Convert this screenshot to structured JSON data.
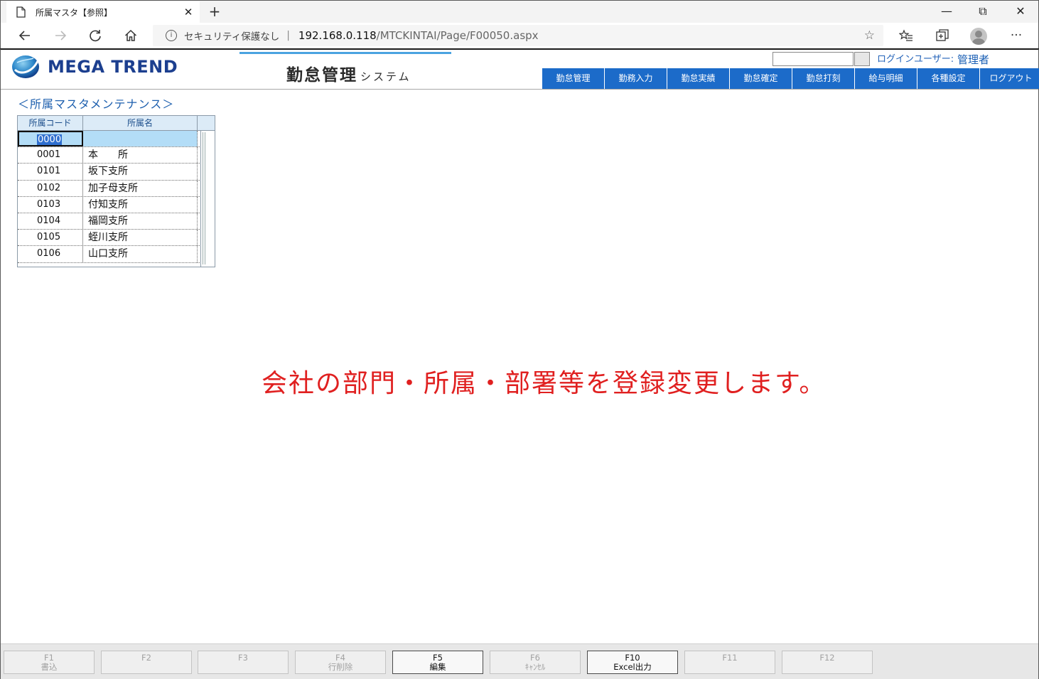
{
  "browser": {
    "tab_title": "所属マスタ【参照】",
    "tab_close": "✕",
    "new_tab": "+",
    "minimize": "—",
    "restore": "⧉",
    "close": "✕",
    "security_label": "セキュリティ保護なし",
    "separator": "|",
    "url_host": "192.168.0.118",
    "url_path": "/MTCKINTAI/Page/F00050.aspx",
    "more": "···"
  },
  "header": {
    "brand": "MEGA TREND",
    "system_title": "勤怠管理",
    "system_subtitle": "システム",
    "login_label": "ログインユーザー:",
    "login_user": "管理者",
    "menu": [
      "勤怠管理",
      "勤務入力",
      "勤怠実績",
      "勤怠確定",
      "勤怠打刻",
      "給与明細",
      "各種設定",
      "ログアウト"
    ]
  },
  "main": {
    "heading": "＜所属マスタメンテナンス＞",
    "grid": {
      "columns": [
        "所属コード",
        "所属名"
      ],
      "rows": [
        {
          "code": "0000",
          "name": ""
        },
        {
          "code": "0001",
          "name": "本　　所"
        },
        {
          "code": "0101",
          "name": "坂下支所"
        },
        {
          "code": "0102",
          "name": "加子母支所"
        },
        {
          "code": "0103",
          "name": "付知支所"
        },
        {
          "code": "0104",
          "name": "福岡支所"
        },
        {
          "code": "0105",
          "name": "蛭川支所"
        },
        {
          "code": "0106",
          "name": "山口支所"
        }
      ]
    },
    "note": "会社の部門・所属・部署等を登録変更します。"
  },
  "function_keys": [
    {
      "key": "F1",
      "label": "書込",
      "enabled": false
    },
    {
      "key": "F2",
      "label": "",
      "enabled": false
    },
    {
      "key": "F3",
      "label": "",
      "enabled": false
    },
    {
      "key": "F4",
      "label": "行削除",
      "enabled": false
    },
    {
      "key": "F5",
      "label": "編集",
      "enabled": true
    },
    {
      "key": "F6",
      "label": "ｷｬﾝｾﾙ",
      "enabled": false
    },
    {
      "key": "F10",
      "label": "Excel出力",
      "enabled": true
    },
    {
      "key": "F11",
      "label": "",
      "enabled": false
    },
    {
      "key": "F12",
      "label": "",
      "enabled": false
    }
  ],
  "colors": {
    "menu_bg": "#1c6bc9",
    "note_red": "#e02020",
    "heading_blue": "#1d5fae",
    "selected_row": "#b3ddf7"
  }
}
